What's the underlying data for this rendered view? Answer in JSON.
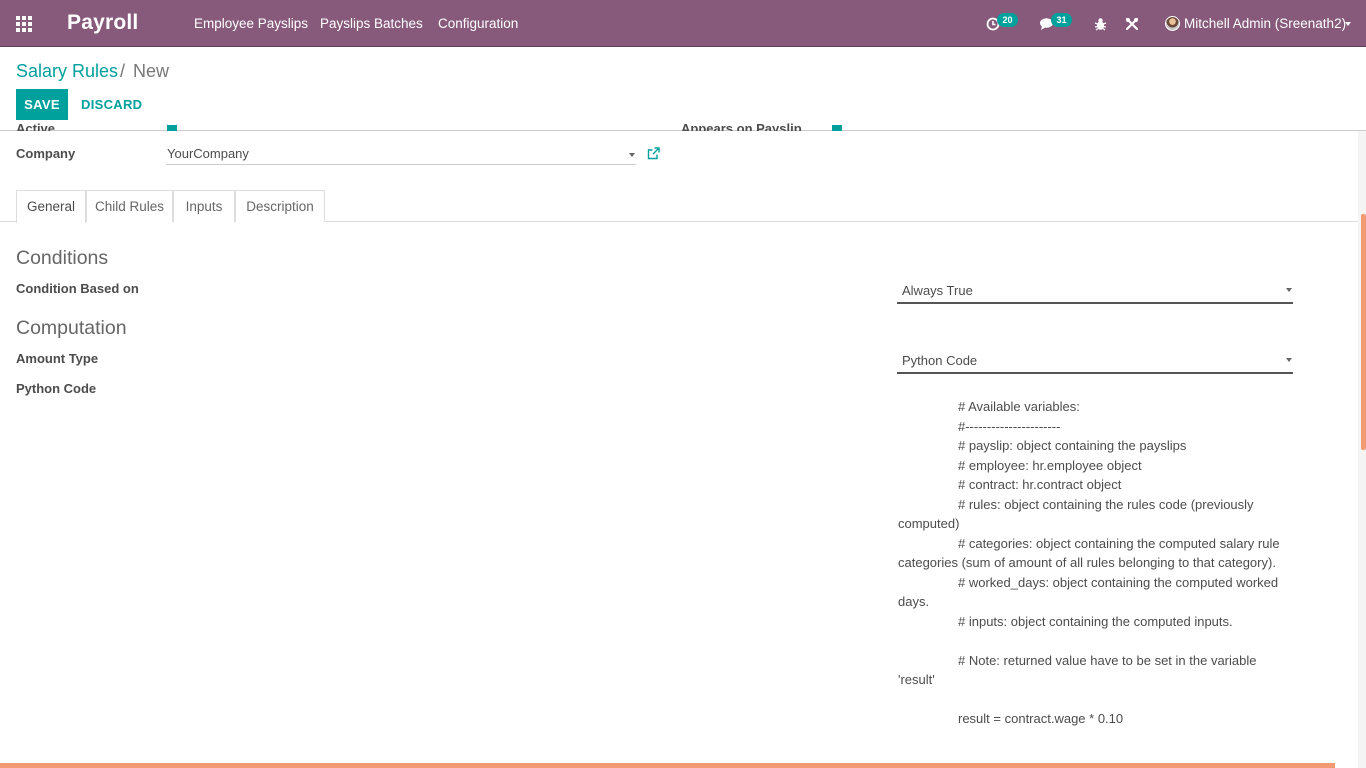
{
  "topbar": {
    "app_name": "Payroll",
    "menu": [
      {
        "label": "Employee Payslips"
      },
      {
        "label": "Payslips Batches"
      },
      {
        "label": "Configuration"
      }
    ],
    "activity_count": "20",
    "messages_count": "31",
    "user_name": "Mitchell Admin (Sreenath2)",
    "brand_color": "#875a7b",
    "badge_color": "#00a09d"
  },
  "breadcrumb": {
    "parent": "Salary Rules",
    "separator": "/",
    "current": "New"
  },
  "buttons": {
    "save": "SAVE",
    "discard": "DISCARD"
  },
  "partial_fields": {
    "active_label": "Active",
    "appears_label": "Appears on Payslip"
  },
  "company": {
    "label": "Company",
    "value": "YourCompany"
  },
  "tabs": [
    {
      "label": "General",
      "active": true
    },
    {
      "label": "Child Rules",
      "active": false
    },
    {
      "label": "Inputs",
      "active": false
    },
    {
      "label": "Description",
      "active": false
    }
  ],
  "conditions": {
    "title": "Conditions",
    "condition_label": "Condition Based on",
    "condition_value": "Always True"
  },
  "computation": {
    "title": "Computation",
    "amount_type_label": "Amount Type",
    "amount_type_value": "Python Code",
    "python_code_label": "Python Code",
    "python_code_lines": [
      "# Available variables:",
      "#----------------------",
      "# payslip: object containing the payslips",
      "# employee: hr.employee object",
      "# contract: hr.contract object",
      "# rules: object containing the rules code (previously computed)",
      "# categories: object containing the computed salary rule categories (sum of amount of all rules belonging to that category).",
      "# worked_days: object containing the computed worked days.",
      "# inputs: object containing the computed inputs.",
      "",
      "# Note: returned value have to be set in the variable 'result'",
      "",
      "result = contract.wage * 0.10"
    ]
  }
}
